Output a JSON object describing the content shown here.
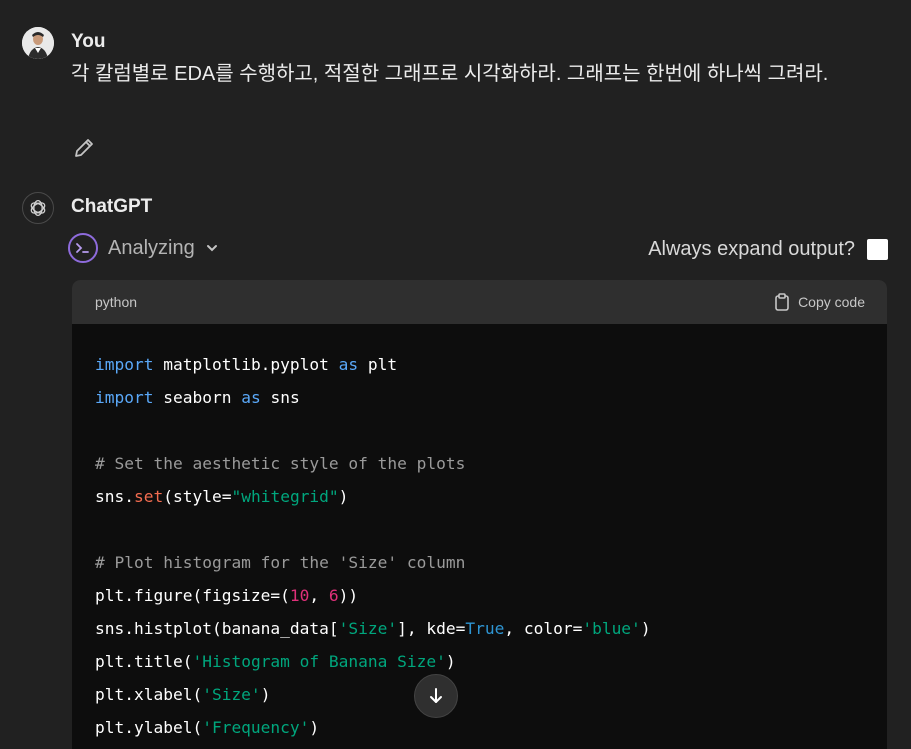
{
  "user": {
    "name": "You",
    "message": "각 칼럼별로 EDA를 수행하고, 적절한 그래프로 시각화하라. 그래프는 한번에 하나씩 그려라."
  },
  "assistant": {
    "name": "ChatGPT",
    "status": "Analyzing",
    "expand_label": "Always expand output?"
  },
  "code_block": {
    "language": "python",
    "copy_label": "Copy code",
    "lines": [
      [
        {
          "t": "import",
          "c": "kw"
        },
        {
          "t": " matplotlib.pyplot ",
          "c": ""
        },
        {
          "t": "as",
          "c": "kw"
        },
        {
          "t": " plt",
          "c": ""
        }
      ],
      [
        {
          "t": "import",
          "c": "kw"
        },
        {
          "t": " seaborn ",
          "c": ""
        },
        {
          "t": "as",
          "c": "kw"
        },
        {
          "t": " sns",
          "c": ""
        }
      ],
      [],
      [
        {
          "t": "# Set the aesthetic style of the plots",
          "c": "cm"
        }
      ],
      [
        {
          "t": "sns.",
          "c": ""
        },
        {
          "t": "set",
          "c": "fn"
        },
        {
          "t": "(style=",
          "c": ""
        },
        {
          "t": "\"whitegrid\"",
          "c": "str"
        },
        {
          "t": ")",
          "c": ""
        }
      ],
      [],
      [
        {
          "t": "# Plot histogram for the 'Size' column",
          "c": "cm"
        }
      ],
      [
        {
          "t": "plt.figure(figsize=(",
          "c": ""
        },
        {
          "t": "10",
          "c": "num"
        },
        {
          "t": ", ",
          "c": ""
        },
        {
          "t": "6",
          "c": "num"
        },
        {
          "t": "))",
          "c": ""
        }
      ],
      [
        {
          "t": "sns.histplot(banana_data[",
          "c": ""
        },
        {
          "t": "'Size'",
          "c": "str"
        },
        {
          "t": "], kde=",
          "c": ""
        },
        {
          "t": "True",
          "c": "const"
        },
        {
          "t": ", color=",
          "c": ""
        },
        {
          "t": "'blue'",
          "c": "str"
        },
        {
          "t": ")",
          "c": ""
        }
      ],
      [
        {
          "t": "plt.title(",
          "c": ""
        },
        {
          "t": "'Histogram of Banana Size'",
          "c": "str"
        },
        {
          "t": ")",
          "c": ""
        }
      ],
      [
        {
          "t": "plt.xlabel(",
          "c": ""
        },
        {
          "t": "'Size'",
          "c": "str"
        },
        {
          "t": ")",
          "c": ""
        }
      ],
      [
        {
          "t": "plt.ylabel(",
          "c": ""
        },
        {
          "t": "'Frequency'",
          "c": "str"
        },
        {
          "t": ")",
          "c": ""
        }
      ]
    ]
  },
  "icons": [
    "avatar",
    "edit-icon",
    "chatgpt-logo-icon",
    "terminal-icon",
    "chevron-down-icon",
    "clipboard-icon",
    "arrow-down-icon"
  ],
  "colors": {
    "background": "#212121",
    "code_background": "#0d0d0d",
    "code_header": "#2f2f2f",
    "accent_purple": "#8e6bdc",
    "keyword": "#5aa8f8",
    "function": "#f26c50",
    "string": "#00a67d",
    "number": "#df3079",
    "comment": "#9a9a9a"
  }
}
